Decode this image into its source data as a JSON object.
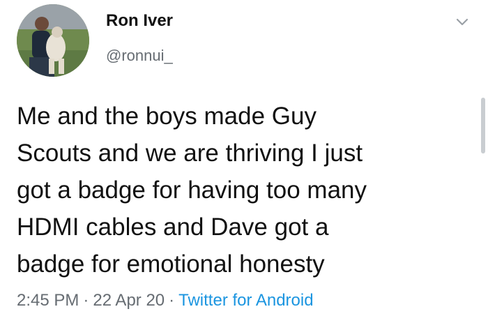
{
  "user": {
    "display_name": "Ron Iver",
    "handle": "@ronnui_",
    "avatar_icon": "profile-photo"
  },
  "tweet": {
    "lines": [
      "Me and the boys made Guy",
      "Scouts and we are thriving I just",
      "got a badge for having too many",
      "HDMI cables and Dave got a",
      "badge for emotional honesty"
    ]
  },
  "meta": {
    "time": "2:45 PM",
    "separator": "·",
    "date": "22 Apr 20",
    "source": "Twitter for Android"
  },
  "colors": {
    "link": "#1b95e0",
    "muted": "#666c72",
    "text": "#111111"
  },
  "icons": {
    "menu": "chevron-down-icon"
  }
}
